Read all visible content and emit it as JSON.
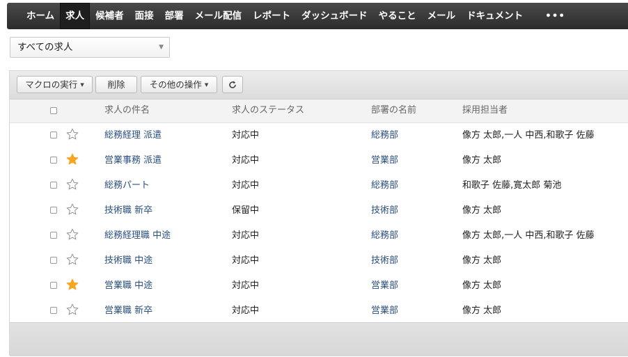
{
  "nav": {
    "items": [
      "ホーム",
      "求人",
      "候補者",
      "面接",
      "部署",
      "メール配信",
      "レポート",
      "ダッシュボード",
      "やること",
      "メール",
      "ドキュメント"
    ],
    "more": "•••"
  },
  "filter": {
    "selected": "すべての求人"
  },
  "toolbar": {
    "macro": "マクロの実行",
    "delete": "削除",
    "other": "その他の操作",
    "refresh_icon": "refresh-icon"
  },
  "table": {
    "headers": {
      "title": "求人の件名",
      "status": "求人のステータス",
      "dept": "部署の名前",
      "recruiter": "採用担当者"
    },
    "rows": [
      {
        "starred": false,
        "title": "総務経理 派遣",
        "status": "対応中",
        "dept": "総務部",
        "recruiter": "像方 太郎,一人 中西,和歌子 佐藤"
      },
      {
        "starred": true,
        "title": "営業事務 派遣",
        "status": "対応中",
        "dept": "営業部",
        "recruiter": "像方 太郎"
      },
      {
        "starred": false,
        "title": "総務パート",
        "status": "対応中",
        "dept": "総務部",
        "recruiter": "和歌子 佐藤,寛太郎 菊池"
      },
      {
        "starred": false,
        "title": "技術職 新卒",
        "status": "保留中",
        "dept": "技術部",
        "recruiter": "像方 太郎"
      },
      {
        "starred": false,
        "title": "総務経理職 中途",
        "status": "対応中",
        "dept": "総務部",
        "recruiter": "像方 太郎,一人 中西,和歌子 佐藤"
      },
      {
        "starred": false,
        "title": "技術職 中途",
        "status": "対応中",
        "dept": "技術部",
        "recruiter": "像方 太郎"
      },
      {
        "starred": true,
        "title": "営業職 中途",
        "status": "対応中",
        "dept": "営業部",
        "recruiter": "像方 太郎"
      },
      {
        "starred": false,
        "title": "営業職 新卒",
        "status": "対応中",
        "dept": "営業部",
        "recruiter": "像方 太郎"
      }
    ]
  },
  "colors": {
    "link": "#2a4f7f",
    "star_on": "#f5a623",
    "star_off": "#9a9a9a",
    "nav_bg": "#333333"
  }
}
